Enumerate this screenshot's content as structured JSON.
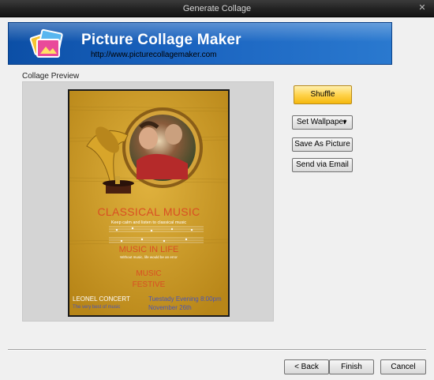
{
  "window": {
    "title": "Generate Collage",
    "close_glyph": "✕"
  },
  "banner": {
    "title": "Picture Collage Maker",
    "url": "http://www.picturecollagemaker.com",
    "logo_icon": "photo-stack-icon"
  },
  "preview": {
    "label": "Collage Preview",
    "poster": {
      "title": "CLASSICAL MUSIC",
      "subtitle": "Keep calm and listen to classical music",
      "life": "MUSIC IN LIFE",
      "tiny": "Without music, life would be an error",
      "festive_line1": "MUSIC",
      "festive_line2": "FESTIVE",
      "concert": "LEONEL CONCERT",
      "best": "The very best of music",
      "when": "Tuestady Evening  8:00pm",
      "date": "November 26th"
    }
  },
  "actions": {
    "shuffle": "Shuffle",
    "set_wallpaper": "Set Wallpaper",
    "save_as_picture": "Save As Picture",
    "send_via_email": "Send via Email"
  },
  "footer": {
    "back": "< Back",
    "finish": "Finish",
    "cancel": "Cancel"
  },
  "colors": {
    "banner": "#1a63bf",
    "poster_bg": "#c99a25",
    "accent_orange": "#d94f23",
    "shuffle": "#ffd34d"
  }
}
